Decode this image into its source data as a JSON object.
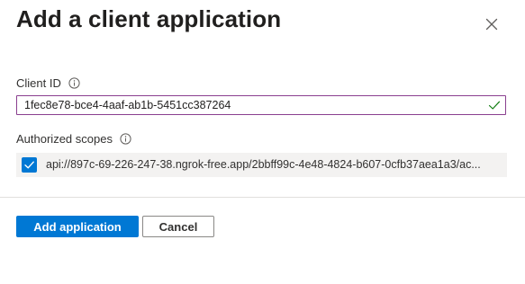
{
  "dialog": {
    "title": "Add a client application"
  },
  "client_id": {
    "label": "Client ID",
    "value": "1fec8e78-bce4-4aaf-ab1b-5451cc387264",
    "valid": true
  },
  "authorized_scopes": {
    "label": "Authorized scopes",
    "items": [
      {
        "checked": true,
        "text": "api://897c-69-226-247-38.ngrok-free.app/2bbff99c-4e48-4824-b607-0cfb37aea1a3/ac..."
      }
    ]
  },
  "buttons": {
    "add_label": "Add application",
    "cancel_label": "Cancel"
  },
  "colors": {
    "primary": "#0078d4",
    "input_border_focus": "#8a3f8f",
    "valid_check": "#107c10",
    "scope_row_bg": "#f3f2f1"
  },
  "icons": [
    "close-icon",
    "info-icon",
    "checkmark-valid-icon",
    "checkbox-checked-icon"
  ]
}
